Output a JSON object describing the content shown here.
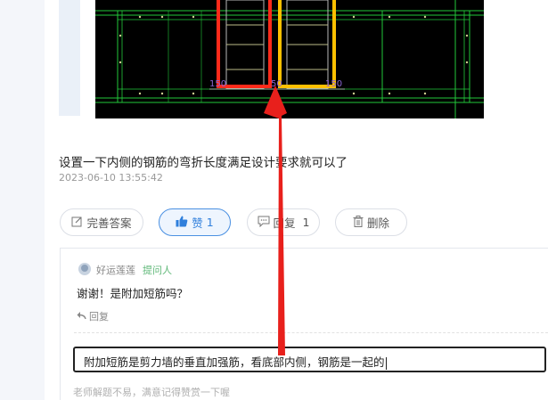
{
  "cad_figure": {
    "dimension_labels": [
      "150",
      "50",
      "150"
    ]
  },
  "answer": {
    "text": "设置一下内侧的钢筋的弯折长度满足设计要求就可以了",
    "timestamp": "2023-06-10 13:55:42"
  },
  "actions": {
    "improve_label": "完善答案",
    "like_label": "赞",
    "like_count": "1",
    "reply_label": "回复",
    "reply_count": "1",
    "delete_label": "删除"
  },
  "comment": {
    "user_name": "好运莲莲",
    "asker_tag": "提问人",
    "text": "谢谢！是附加短筋吗？",
    "reply_label": "回复"
  },
  "reply_input": {
    "value": "附加短筋是剪力墙的垂直加强筋，看底部内侧，钢筋是一起的"
  },
  "hint": "老师解题不易，满意记得赞赏一下喔",
  "colors": {
    "accent": "#2f7fdc",
    "asker_tag": "#5fb878",
    "annotation_red": "#e8201c",
    "rebar_red": "#ff2a1a",
    "rebar_yellow": "#ffc000",
    "cad_green": "#22c83a"
  }
}
